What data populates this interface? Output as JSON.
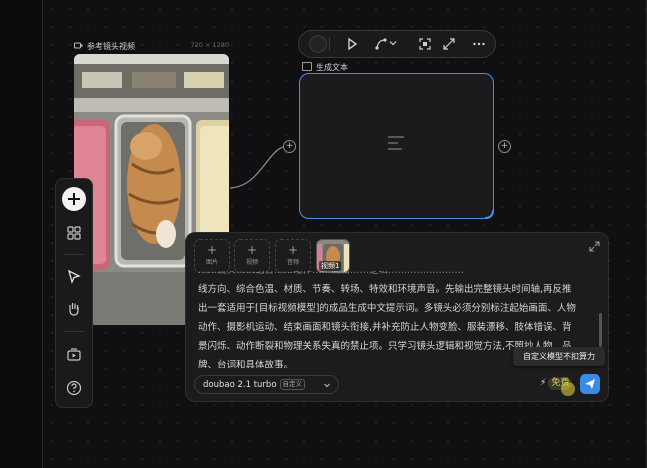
{
  "reference_video": {
    "title": "参考镜头视频",
    "resolution": "720 × 1280",
    "thumbnail_icon": "video-camera-icon"
  },
  "node_toolbar": {
    "items": [
      "circle-swatch",
      "play-icon",
      "curve-icon",
      "chevron-down-icon",
      "focus-icon",
      "expand-icon",
      "more-icon"
    ]
  },
  "generate_node": {
    "title": "生成文本",
    "placeholder_icon": "text-lines-icon"
  },
  "left_toolbar": {
    "items": [
      "plus-icon",
      "grid-icon",
      "cursor-icon",
      "hand-icon",
      "media-icon",
      "help-icon"
    ]
  },
  "input_panel": {
    "attach": [
      {
        "label": "图片",
        "icon": "plus-icon"
      },
      {
        "label": "视频",
        "icon": "plus-icon"
      },
      {
        "label": "音频",
        "icon": "plus-icon"
      }
    ],
    "attached_clip_label": "视频1",
    "prompt_lines": [
      "……镜头……结合……动作……画面……逻辑……………………",
      "线方向、综合色温、材质、节奏、转场、特效和环境声音。先输出完整镜头时间轴,再反推",
      "出一套适用于[目标视频模型]的成品生成中文提示词。多镜头必须分别标注起始画面、人物",
      "动作、摄影机运动、结束画面和镜头衔接,并补充防止人物变脸、服装漂移、肢体错误、背",
      "景闪烁、动作断裂和物理关系失真的禁止项。只学习镜头逻辑和视觉方法,不照抄人物、品",
      "牌、台词和具体故事。"
    ],
    "model": {
      "name": "doubao 2.1 turbo",
      "badge": "自定义"
    },
    "free_label": "免费",
    "tooltip": "自定义模型不扣算力",
    "send_icon": "paper-plane-icon",
    "expand_icon": "expand-corner-icon"
  }
}
